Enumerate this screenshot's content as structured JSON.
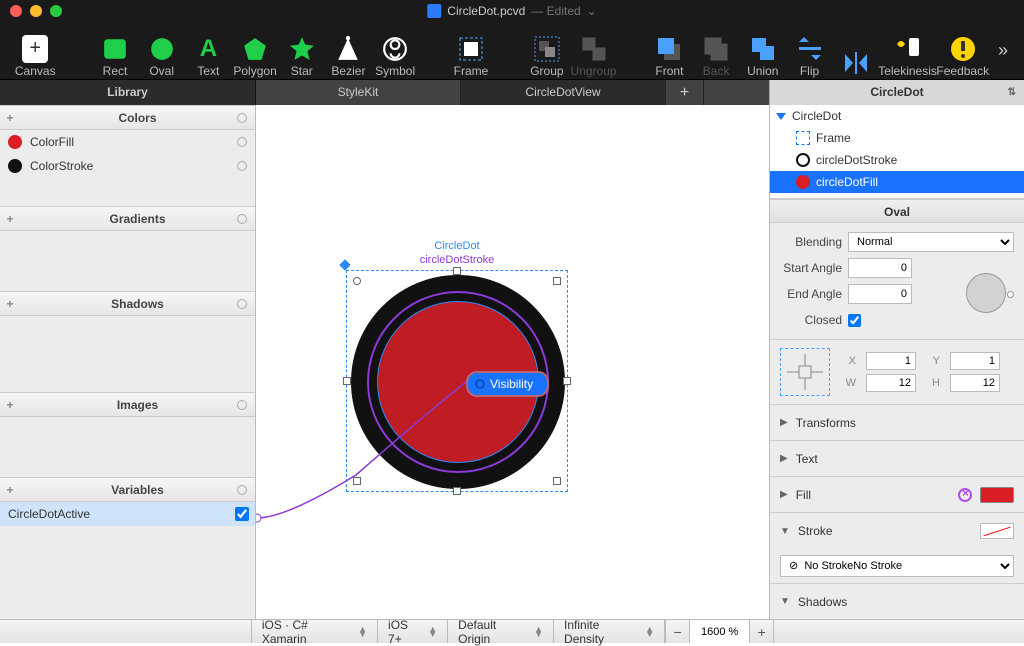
{
  "document": {
    "filename": "CircleDot.pcvd",
    "edited": "— Edited"
  },
  "toolbar": {
    "canvas": "Canvas",
    "rect": "Rect",
    "oval": "Oval",
    "text": "Text",
    "polygon": "Polygon",
    "star": "Star",
    "bezier": "Bezier",
    "symbol": "Symbol",
    "frame": "Frame",
    "group": "Group",
    "ungroup": "Ungroup",
    "front": "Front",
    "back": "Back",
    "union": "Union",
    "flip": "Flip",
    "telekinesis": "Telekinesis",
    "feedback": "Feedback"
  },
  "tabs": {
    "library": "Library",
    "stylekit": "StyleKit",
    "doc_tab": "CircleDotView",
    "inspector_title": "CircleDot"
  },
  "library": {
    "colors_hdr": "Colors",
    "colors": [
      {
        "name": "ColorFill",
        "swatch": "#d91e26"
      },
      {
        "name": "ColorStroke",
        "swatch": "#111111"
      }
    ],
    "gradients_hdr": "Gradients",
    "shadows_hdr": "Shadows",
    "images_hdr": "Images",
    "variables_hdr": "Variables",
    "variables": [
      {
        "name": "CircleDotActive",
        "checked": true
      }
    ]
  },
  "canvas_obj": {
    "name": "CircleDot",
    "stroke_name": "circleDotStroke",
    "pill": "Visibility"
  },
  "tree": {
    "root": "CircleDot",
    "children": [
      {
        "name": "Frame",
        "icon": "frame"
      },
      {
        "name": "circleDotStroke",
        "icon": "stroke"
      },
      {
        "name": "circleDotFill",
        "icon": "fill",
        "selected": true
      }
    ]
  },
  "inspector": {
    "oval_hdr": "Oval",
    "blending_lbl": "Blending",
    "blending_val": "Normal",
    "start_angle_lbl": "Start Angle",
    "start_angle_val": "0",
    "end_angle_lbl": "End Angle",
    "end_angle_val": "0",
    "closed_lbl": "Closed",
    "closed_val": true,
    "dims": {
      "x_lbl": "X",
      "x": "1",
      "y_lbl": "Y",
      "y": "1",
      "w_lbl": "W",
      "w": "12",
      "h_lbl": "H",
      "h": "12"
    },
    "transforms_hdr": "Transforms",
    "text_hdr": "Text",
    "fill_hdr": "Fill",
    "stroke_hdr": "Stroke",
    "no_stroke": "No Stroke",
    "shadows_hdr": "Shadows"
  },
  "statusbar": {
    "platform": "iOS · C# Xamarin",
    "os": "iOS 7+",
    "origin": "Default Origin",
    "density": "Infinite Density",
    "zoom": "1600 %"
  }
}
